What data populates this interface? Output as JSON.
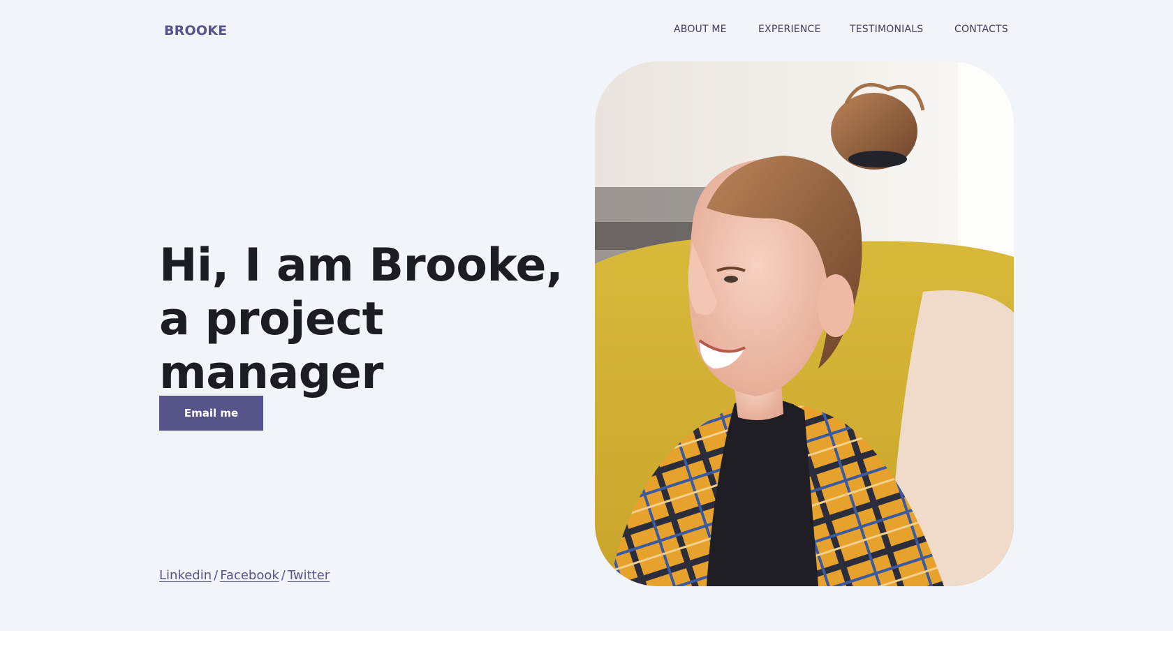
{
  "header": {
    "logo": "BROOKE",
    "nav": [
      {
        "label": "ABOUT ME"
      },
      {
        "label": "EXPERIENCE"
      },
      {
        "label": "TESTIMONIALS"
      },
      {
        "label": "CONTACTS"
      }
    ]
  },
  "hero": {
    "headline": "Hi, I am Brooke, a project manager",
    "cta_label": "Email me",
    "social": {
      "links": [
        "Linkedin",
        "Facebook",
        "Twitter"
      ],
      "separator": "/"
    }
  },
  "colors": {
    "accent": "#575489",
    "hero_background": "#f1f4f8",
    "headline": "#1b1c24"
  }
}
